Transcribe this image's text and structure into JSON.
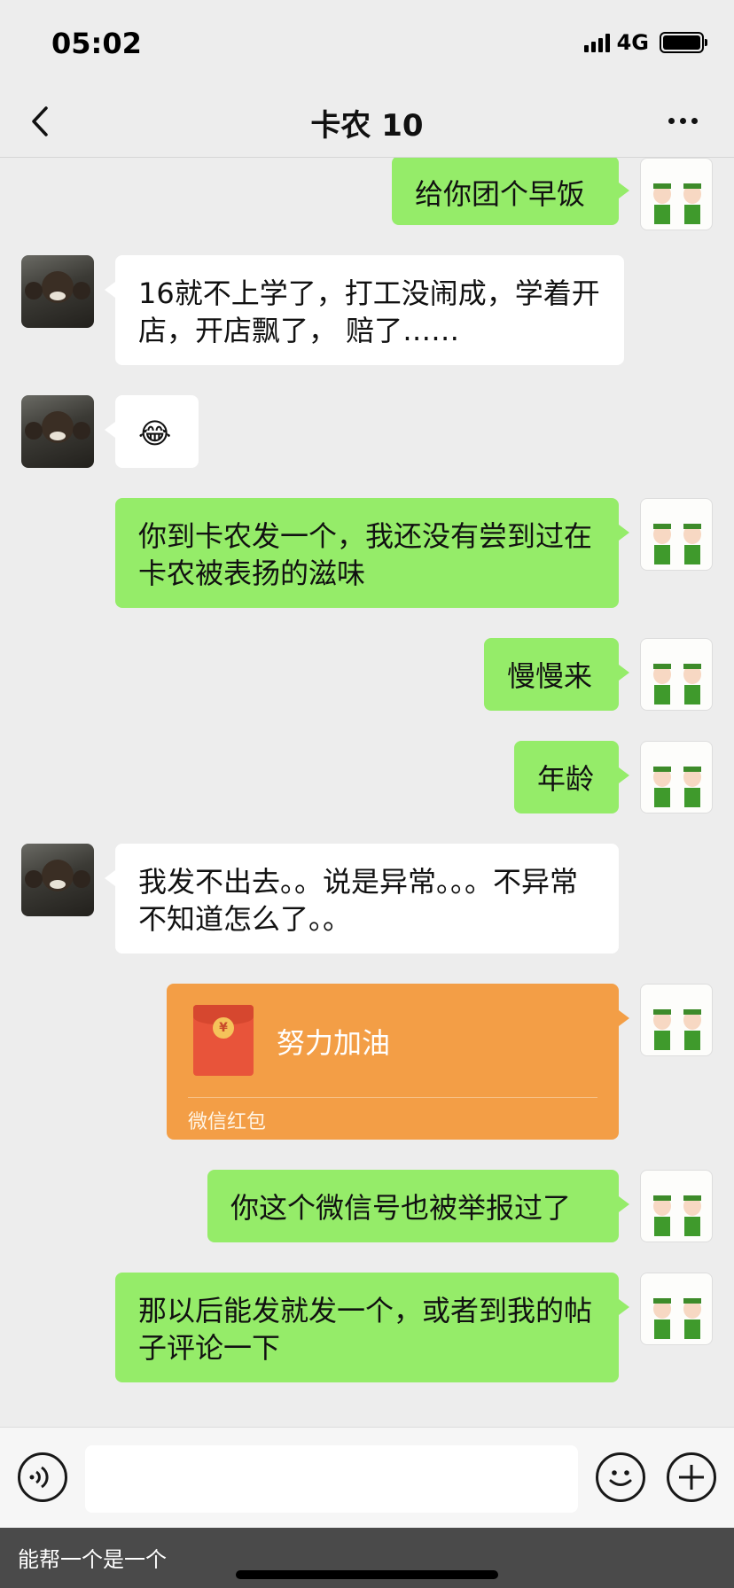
{
  "status_bar": {
    "time": "05:02",
    "network": "4G"
  },
  "header": {
    "title": "卡农 10"
  },
  "messages": [
    {
      "side": "right",
      "text": "给你团个早饭"
    },
    {
      "side": "left",
      "text": "16就不上学了，打工没闹成，学着开店，开店飘了， 赔了……"
    },
    {
      "side": "left",
      "text": "😂"
    },
    {
      "side": "right",
      "text": "你到卡农发一个，我还没有尝到过在卡农被表扬的滋味"
    },
    {
      "side": "right",
      "text": "慢慢来"
    },
    {
      "side": "right",
      "text": "年龄"
    },
    {
      "side": "left",
      "text": "我发不出去。。说是异常。。。不异常不知道怎么了。。"
    },
    {
      "side": "right",
      "type": "red_packet",
      "title": "努力加油",
      "label": "微信红包"
    },
    {
      "side": "right",
      "text": "你这个微信号也被举报过了"
    },
    {
      "side": "right",
      "text": "那以后能发就发一个，或者到我的帖子评论一下"
    }
  ],
  "input": {
    "placeholder": ""
  },
  "icons": {
    "voice": "voice-icon",
    "emoji": "emoji-icon",
    "plus": "plus-icon",
    "back": "back-icon",
    "more": "more-icon"
  },
  "caption": "能帮一个是一个",
  "colors": {
    "bubble_out": "#95ec69",
    "bubble_in": "#ffffff",
    "red_packet": "#f39e46",
    "background": "#ededed"
  }
}
